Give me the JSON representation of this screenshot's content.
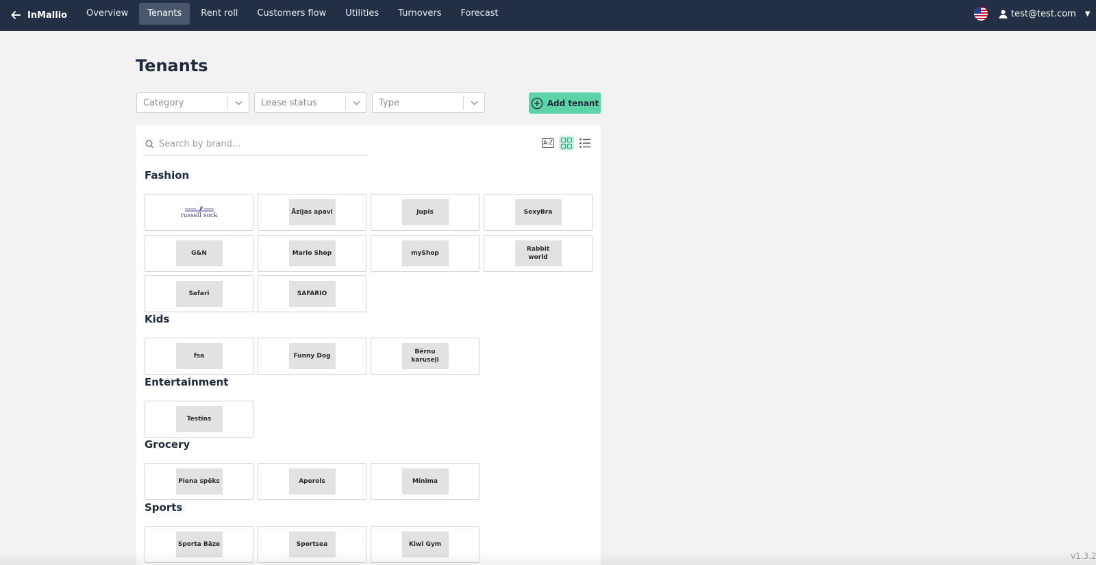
{
  "app": {
    "name": "InMallio",
    "version": "v1.3.2"
  },
  "nav": {
    "back_icon": "arrow-left-icon",
    "items": [
      {
        "label": "Overview",
        "active": false
      },
      {
        "label": "Tenants",
        "active": true
      },
      {
        "label": "Rent roll",
        "active": false
      },
      {
        "label": "Customers flow",
        "active": false
      },
      {
        "label": "Utilities",
        "active": false
      },
      {
        "label": "Turnovers",
        "active": false
      },
      {
        "label": "Forecast",
        "active": false
      }
    ],
    "user": {
      "email": "test@test.com",
      "icon": "user-icon"
    },
    "language_flag": "us-flag-icon"
  },
  "page": {
    "title": "Tenants",
    "filters": {
      "category_placeholder": "Category",
      "lease_status_placeholder": "Lease status",
      "type_placeholder": "Type"
    },
    "add_button_label": "Add tenant",
    "search_placeholder": "Search by brand...",
    "view_sort_label": "A-Z",
    "active_view": "grid"
  },
  "categories": [
    {
      "name": "Fashion",
      "tenants": [
        "russell sock",
        "Āzijas apavi",
        "Jupis",
        "SexyBra",
        "G&N",
        "Mario Shop",
        "myShop",
        "Rabbit world",
        "Safari",
        "SAFARIO"
      ]
    },
    {
      "name": "Kids",
      "tenants": [
        "fsa",
        "Funny Dog",
        "Bērnu karuseļi"
      ]
    },
    {
      "name": "Entertainment",
      "tenants": [
        "Testins"
      ]
    },
    {
      "name": "Grocery",
      "tenants": [
        "Piena spēks",
        "Aperols",
        "Minima"
      ]
    },
    {
      "name": "Sports",
      "tenants": [
        "Sporta Bāze",
        "Sportsea",
        "Kiwi Gym"
      ]
    }
  ],
  "colors": {
    "navbar": "#232f45",
    "accent": "#5fd3a8",
    "background": "#f2f2f2"
  }
}
